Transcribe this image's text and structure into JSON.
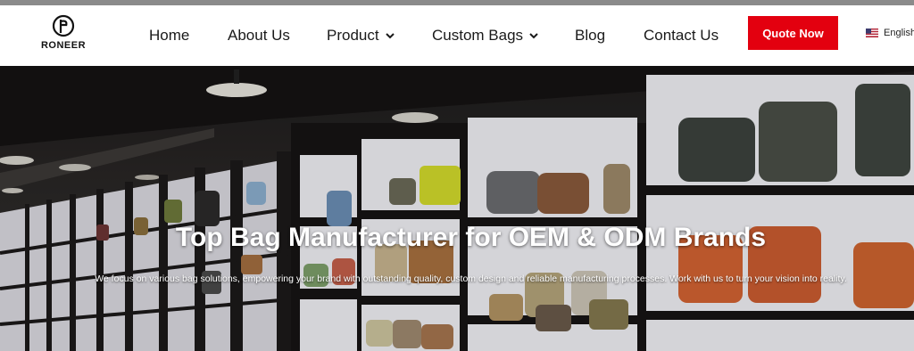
{
  "brand": {
    "name": "RONEER",
    "logo_icon": "roneer-logo-icon"
  },
  "nav": {
    "items": [
      {
        "label": "Home",
        "has_dropdown": false
      },
      {
        "label": "About Us",
        "has_dropdown": false
      },
      {
        "label": "Product",
        "has_dropdown": true
      },
      {
        "label": "Custom Bags",
        "has_dropdown": true
      },
      {
        "label": "Blog",
        "has_dropdown": false
      },
      {
        "label": "Contact Us",
        "has_dropdown": false
      }
    ]
  },
  "cta": {
    "label": "Quote Now",
    "color": "#e3000f"
  },
  "language": {
    "label": "English",
    "flag_icon": "us-flag-icon"
  },
  "hero": {
    "title": "Top Bag Manufacturer for OEM & ODM Brands",
    "subtitle": "We focus on various bag solutions, empowering your brand with outstanding quality, custom design and reliable manufacturing processes. Work with us to turn your vision into reality."
  }
}
